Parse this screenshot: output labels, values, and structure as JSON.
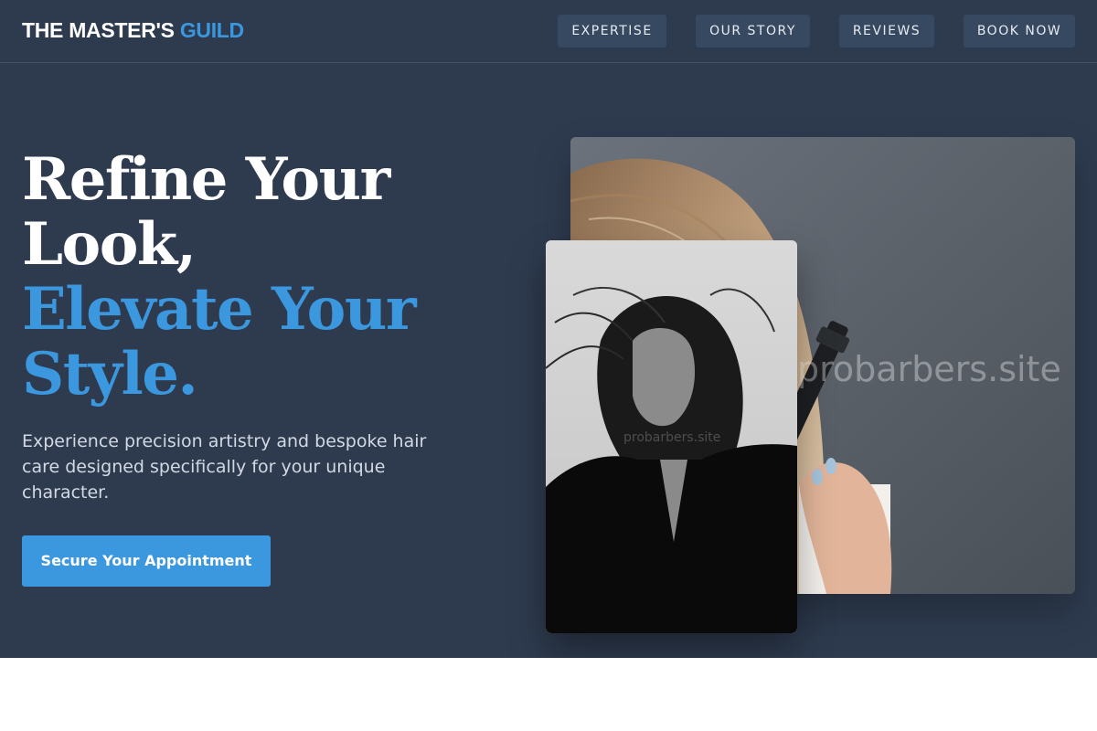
{
  "header": {
    "logo_main": "THE MASTER'S",
    "logo_accent": "GUILD",
    "nav": [
      {
        "label": "EXPERTISE"
      },
      {
        "label": "OUR STORY"
      },
      {
        "label": "REVIEWS"
      },
      {
        "label": "BOOK NOW"
      }
    ]
  },
  "hero": {
    "headline_white": [
      "Refine Your",
      "Look,"
    ],
    "headline_blue": [
      "Elevate Your",
      "Style."
    ],
    "subtext": "Experience precision artistry and bespoke hair care designed specifically for your unique character.",
    "cta_label": "Secure Your Appointment"
  },
  "images": {
    "back_watermark": "probarbers.site",
    "front_watermark": "probarbers.site"
  },
  "colors": {
    "background": "#2e3b4f",
    "nav_button": "#374861",
    "accent": "#3b97de",
    "text_white": "#ffffff",
    "subtext": "#d3d9e2"
  }
}
